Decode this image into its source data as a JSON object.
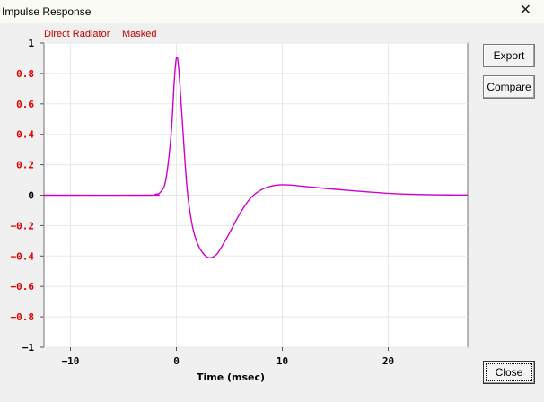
{
  "window": {
    "title": "Impulse Response",
    "close_glyph": "✕"
  },
  "buttons": {
    "export": "Export",
    "compare": "Compare",
    "close": "Close"
  },
  "legend": [
    "Direct Radiator",
    "Masked"
  ],
  "colors": {
    "curve": "#d000d0",
    "ylabels": "#e00000",
    "legend": "#c00000",
    "grid": "#e8e8e8"
  },
  "chart_data": {
    "type": "line",
    "xlabel": "Time (msec)",
    "ylabel": "",
    "xlim": [
      -12.5,
      27.5
    ],
    "ylim": [
      -1,
      1
    ],
    "xticks": [
      -10,
      0,
      10,
      20
    ],
    "xtick_labels": [
      "−10",
      "0",
      "10",
      "20"
    ],
    "yticks": [
      1,
      0.8,
      0.6,
      0.4,
      0.2,
      0,
      -0.2,
      -0.4,
      -0.6,
      -0.8,
      -1
    ],
    "ytick_labels": [
      "1",
      "0.8",
      "0.6",
      "0.4",
      "0.2",
      "0",
      "−0.2",
      "−0.4",
      "−0.6",
      "−0.8",
      "−1"
    ],
    "grid": true,
    "series": [
      {
        "x": [
          -12.5,
          -2.5,
          -2,
          -1.5,
          -1,
          -0.5,
          -0.2,
          0,
          0.2,
          0.5,
          1,
          1.5,
          2,
          2.5,
          3,
          3.5,
          4,
          5,
          6,
          7,
          8,
          9,
          10,
          11,
          12,
          14,
          16,
          18,
          20,
          22,
          25,
          27.5
        ],
        "y": [
          0,
          0,
          0.005,
          0.02,
          0.1,
          0.4,
          0.75,
          0.9,
          0.85,
          0.55,
          0.05,
          -0.2,
          -0.32,
          -0.38,
          -0.41,
          -0.405,
          -0.37,
          -0.25,
          -0.12,
          -0.02,
          0.035,
          0.06,
          0.068,
          0.065,
          0.058,
          0.045,
          0.033,
          0.022,
          0.012,
          0.006,
          0.002,
          0.001
        ]
      }
    ]
  }
}
